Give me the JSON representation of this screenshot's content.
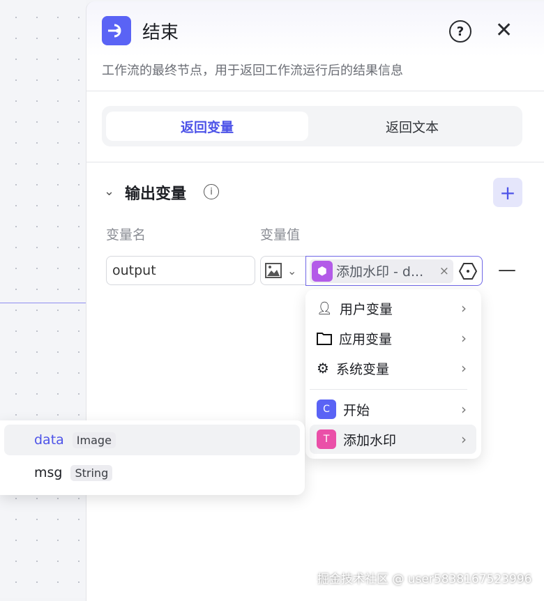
{
  "panel": {
    "title": "结束",
    "description": "工作流的最终节点，用于返回工作流运行后的结果信息",
    "help_icon": "?",
    "close_icon": "✕"
  },
  "tabs": [
    {
      "label": "返回变量",
      "active": true
    },
    {
      "label": "返回文本",
      "active": false
    }
  ],
  "output": {
    "section_title": "输出变量",
    "add_icon": "+",
    "col_name": "变量名",
    "col_value": "变量值",
    "row": {
      "name": "output",
      "ref_label": "添加水印 - d...",
      "ref_clear": "×",
      "remove": "—"
    }
  },
  "menu": {
    "items": [
      {
        "label": "用户变量"
      },
      {
        "label": "应用变量"
      },
      {
        "label": "系统变量"
      },
      {
        "label": "开始"
      },
      {
        "label": "添加水印"
      }
    ]
  },
  "submenu": {
    "items": [
      {
        "name": "data",
        "type": "Image"
      },
      {
        "name": "msg",
        "type": "String"
      }
    ]
  },
  "watermark": "掘金技术社区 @ user5838167523996",
  "colors": {
    "accent": "#4d53e8",
    "node_end": "#5a63f5",
    "node_watermark": "#ea4fa8",
    "chip_icon": "#b35be8"
  }
}
